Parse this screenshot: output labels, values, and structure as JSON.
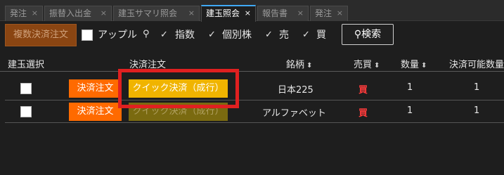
{
  "tabs": [
    {
      "label": "発注",
      "close": "×"
    },
    {
      "label": "振替入出金",
      "close": "×"
    },
    {
      "label": "建玉サマリ照会",
      "close": "×"
    },
    {
      "label": "建玉照会",
      "close": "×"
    },
    {
      "label": "報告書",
      "close": "×"
    },
    {
      "label": "発注",
      "close": "×"
    }
  ],
  "toolbar": {
    "bulk_settle_label": "複数決済注文",
    "filter_apple": "アップル",
    "filter_index": "指数",
    "filter_stock": "個別株",
    "filter_sell": "売",
    "filter_buy": "買",
    "search_label": "検索",
    "check_mark": "✓",
    "search_glyph": "⚲"
  },
  "table": {
    "headers": {
      "select": "建玉選択",
      "settle": "決済注文",
      "symbol": "銘柄",
      "side": "売買",
      "qty": "数量",
      "settleable_qty": "決済可能数量",
      "sort_glyph": "⬍"
    },
    "rows": [
      {
        "settle_label": "決済注文",
        "quick_label": "クイック決済（成行）",
        "symbol": "日本225",
        "side": "買",
        "qty": "1",
        "settleable": "1"
      },
      {
        "settle_label": "決済注文",
        "quick_label": "クイック決済（成行）",
        "symbol": "アルファベット",
        "side": "買",
        "qty": "1",
        "settleable": "1"
      }
    ]
  },
  "colors": {
    "accent_tab": "#3fa9f5",
    "settle_button": "#ff6a00",
    "quick_button": "#f0b400",
    "buy_text": "#ff3b3b",
    "highlight_box": "#e02020"
  }
}
